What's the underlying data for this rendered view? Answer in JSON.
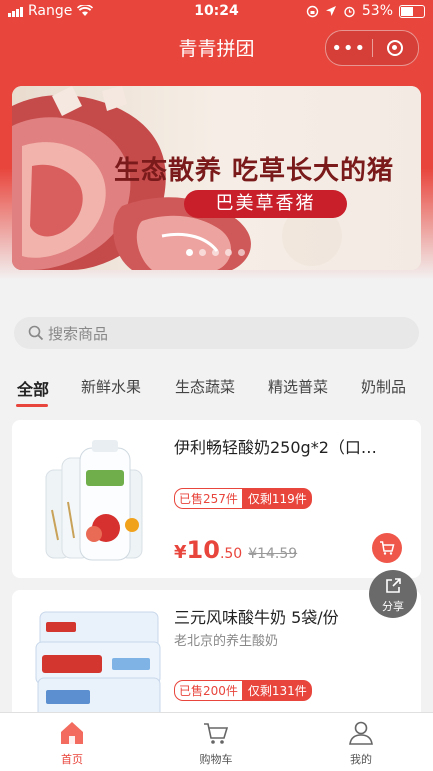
{
  "status_bar": {
    "carrier": "Range",
    "time": "10:24",
    "battery": "53%"
  },
  "nav": {
    "title": "青青拼团",
    "more_icon": "more-dots-icon",
    "target_icon": "target-icon"
  },
  "banner": {
    "headline": "生态散养  吃草长大的猪",
    "tag": "巴美草香猪",
    "dots": 5,
    "active_dot": 0
  },
  "search": {
    "placeholder": "搜索商品"
  },
  "categories": [
    {
      "label": "全部",
      "active": true
    },
    {
      "label": "新鲜水果"
    },
    {
      "label": "生态蔬菜"
    },
    {
      "label": "精选普菜"
    },
    {
      "label": "奶制品"
    }
  ],
  "products": [
    {
      "name": "伊利畅轻酸奶250g*2（口…",
      "subtitle": "",
      "sold": "已售257件",
      "remaining": "仅剩119件",
      "price_currency": "¥",
      "price_int": "10",
      "price_dec": ".50",
      "original_price": "¥14.59"
    },
    {
      "name": "三元风味酸牛奶 5袋/份",
      "subtitle": "老北京的养生酸奶",
      "sold": "已售200件",
      "remaining": "仅剩131件"
    }
  ],
  "share": {
    "label": "分享"
  },
  "tabbar": [
    {
      "label": "首页",
      "icon": "home-icon",
      "active": true
    },
    {
      "label": "购物车",
      "icon": "cart-icon"
    },
    {
      "label": "我的",
      "icon": "user-icon"
    }
  ],
  "colors": {
    "primary": "#e8453c",
    "banner_tag": "#c81f2b"
  }
}
